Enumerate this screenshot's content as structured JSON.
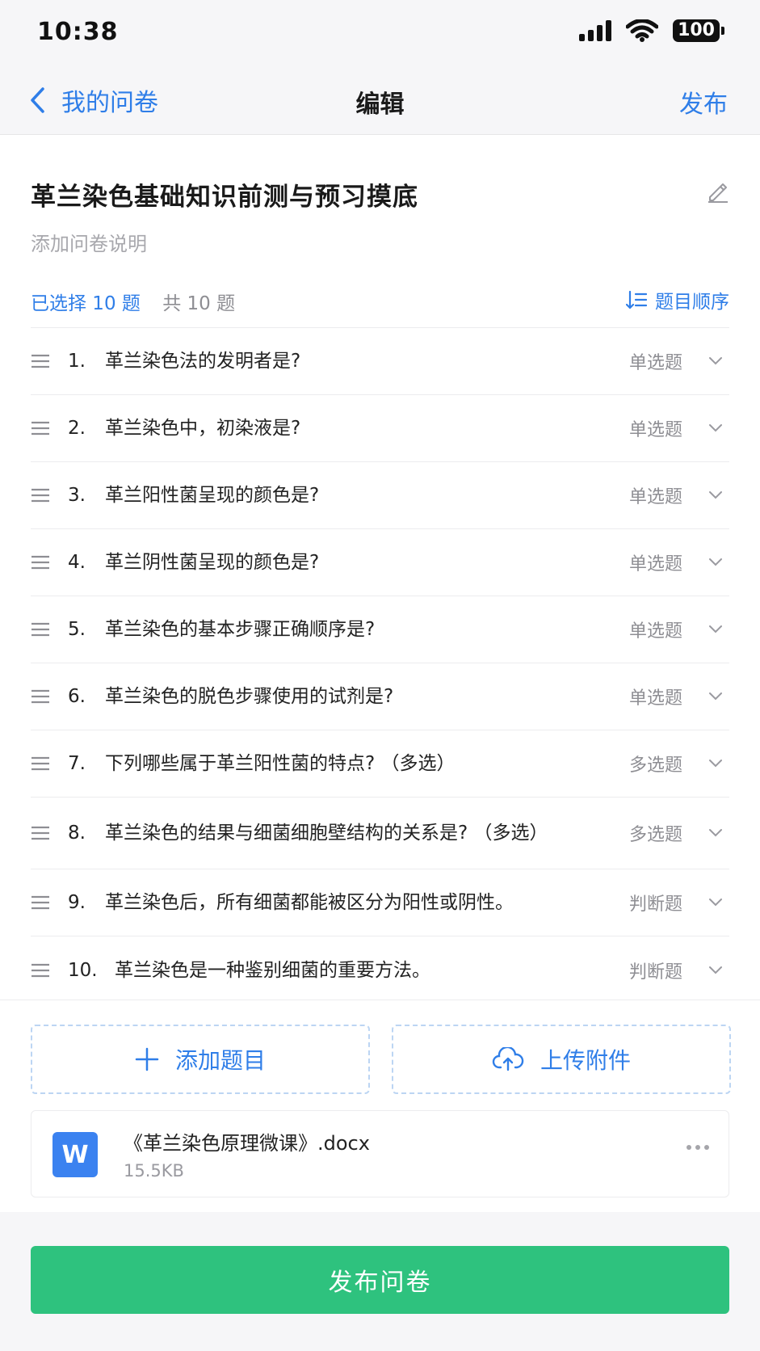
{
  "status_bar": {
    "time": "10:38",
    "battery": "100"
  },
  "nav": {
    "back_label": "我的问卷",
    "title": "编辑",
    "publish_label": "发布"
  },
  "survey": {
    "title": "革兰染色基础知识前测与预习摸底",
    "description_placeholder": "添加问卷说明"
  },
  "summary": {
    "selected": "已选择 10 题",
    "total": "共 10 题",
    "order_label": "题目顺序"
  },
  "questions": [
    {
      "num": "1.",
      "text": "革兰染色法的发明者是?",
      "type": "单选题"
    },
    {
      "num": "2.",
      "text": "革兰染色中，初染液是?",
      "type": "单选题"
    },
    {
      "num": "3.",
      "text": "革兰阳性菌呈现的颜色是?",
      "type": "单选题"
    },
    {
      "num": "4.",
      "text": "革兰阴性菌呈现的颜色是?",
      "type": "单选题"
    },
    {
      "num": "5.",
      "text": "革兰染色的基本步骤正确顺序是?",
      "type": "单选题"
    },
    {
      "num": "6.",
      "text": "革兰染色的脱色步骤使用的试剂是?",
      "type": "单选题"
    },
    {
      "num": "7.",
      "text": "下列哪些属于革兰阳性菌的特点? （多选）",
      "type": "多选题"
    },
    {
      "num": "8.",
      "text": "革兰染色的结果与细菌细胞壁结构的关系是? （多选）",
      "type": "多选题"
    },
    {
      "num": "9.",
      "text": "革兰染色后，所有细菌都能被区分为阳性或阴性。",
      "type": "判断题"
    },
    {
      "num": "10.",
      "text": "革兰染色是一种鉴别细菌的重要方法。",
      "type": "判断题"
    }
  ],
  "actions": {
    "add_label": "添加题目",
    "upload_label": "上传附件"
  },
  "attachment": {
    "icon_letter": "W",
    "name": "《革兰染色原理微课》.docx",
    "size": "15.5KB"
  },
  "publish_button": "发布问卷",
  "colors": {
    "accent": "#2f7ee8",
    "publish": "#2ec27e",
    "doc_icon": "#3b82f0"
  }
}
